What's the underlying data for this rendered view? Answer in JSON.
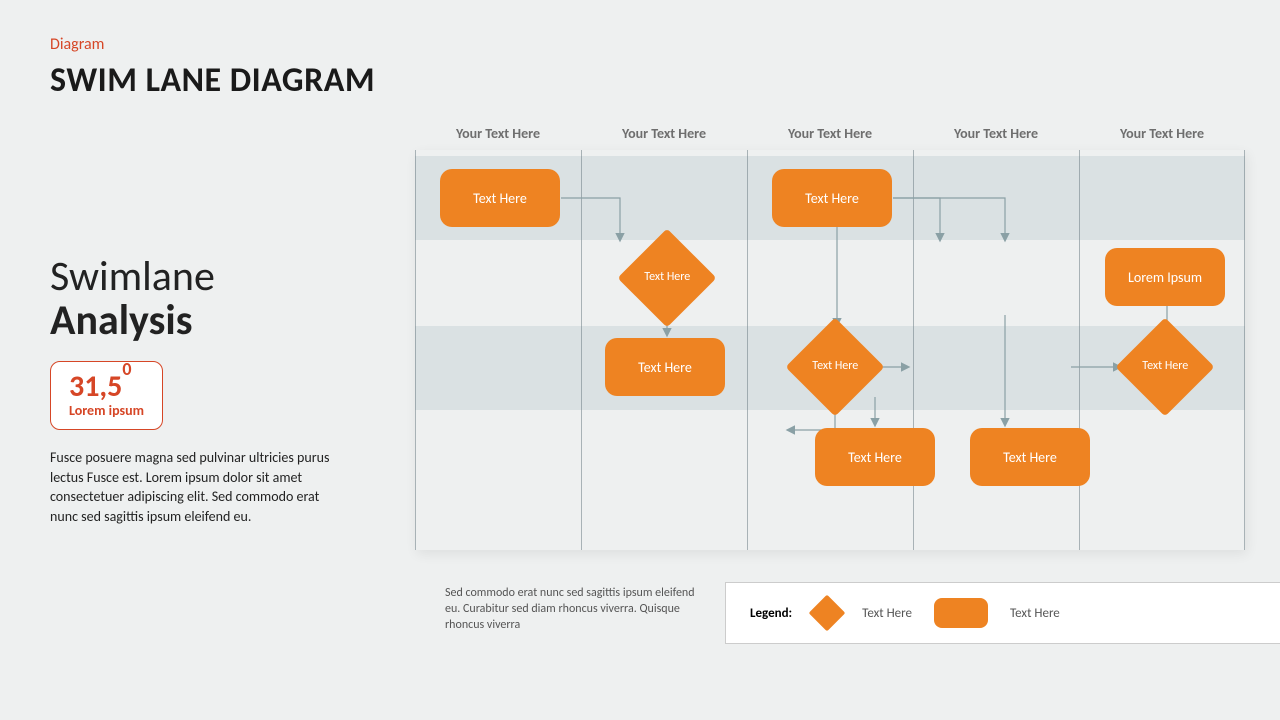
{
  "kicker": "Diagram",
  "slide_title": "SWIM LANE DIAGRAM",
  "analysis": {
    "line1": "Swimlane",
    "line2": "Analysis",
    "stat_value": "31,5",
    "stat_sup": "0",
    "stat_caption": "Lorem ipsum",
    "copy": "Fusce posuere magna sed pulvinar ultricies purus lectus Fusce est. Lorem ipsum dolor sit amet consectetuer adipiscing elit. Sed commodo erat nunc sed sagittis ipsum eleifend eu."
  },
  "columns": [
    "Your Text Here",
    "Your Text Here",
    "Your Text Here",
    "Your Text Here",
    "Your Text Here"
  ],
  "nodes": {
    "n1": "Text Here",
    "n2": "Text Here",
    "d1": "Text Here",
    "n3": "Lorem Ipsum",
    "n4": "Text Here",
    "d2": "Text Here",
    "d3": "Text Here",
    "n5": "Text Here",
    "n6": "Text Here"
  },
  "footnote": "Sed commodo  erat nunc sed sagittis ipsum eleifend eu. Curabitur sed diam rhoncus viverra. Quisque rhoncus  viverra",
  "legend": {
    "title": "Legend:",
    "diamond_label": "Text Here",
    "rect_label": "Text Here"
  }
}
